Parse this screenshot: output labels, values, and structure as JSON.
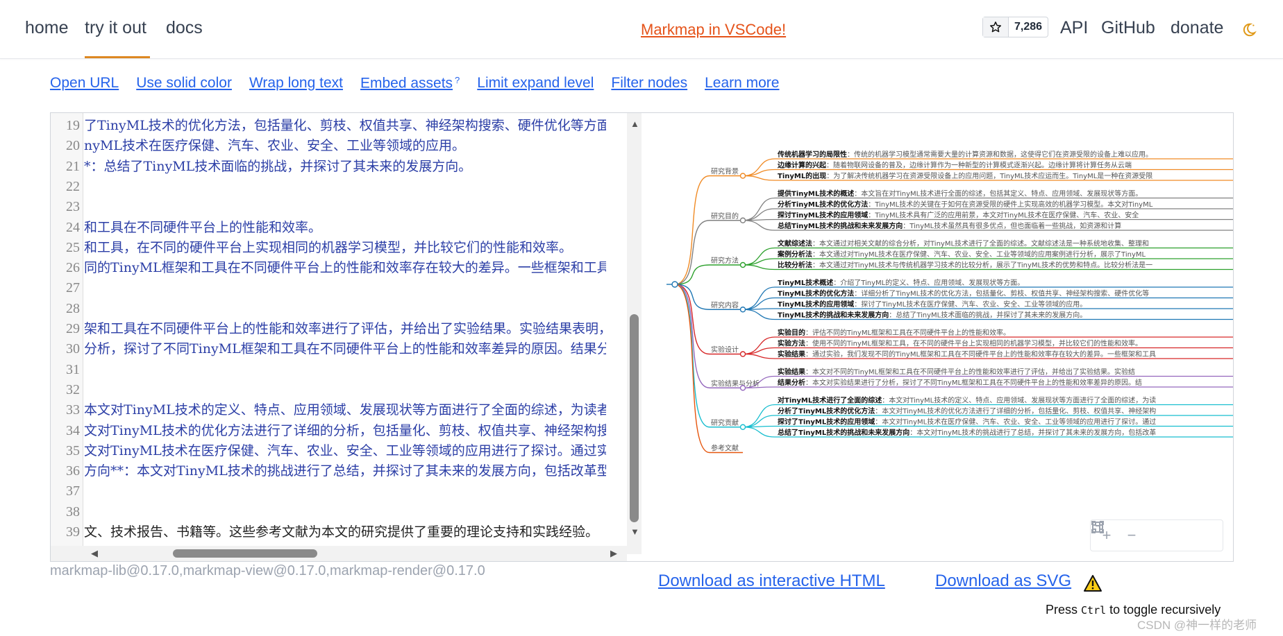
{
  "nav": {
    "items": [
      {
        "label": "home"
      },
      {
        "label": "try it out"
      },
      {
        "label": "docs"
      }
    ],
    "promo": "Markmap in VSCode!",
    "stars": "7,286",
    "right": [
      "API",
      "GitHub",
      "donate"
    ],
    "accent": "#dd8822"
  },
  "toolbar_links": [
    "Open URL",
    "Use solid color",
    "Wrap long text",
    "Embed assets",
    "Limit expand level",
    "Filter nodes",
    "Learn more"
  ],
  "embed_sup": "?",
  "editor": {
    "lines": [
      {
        "n": "19",
        "text": "了TinyML技术的优化方法，包括量化、剪枝、权值共享、神经架构搜索、硬件优化等方面。"
      },
      {
        "n": "20",
        "text": "nyML技术在医疗保健、汽车、农业、安全、工业等领域的应用。"
      },
      {
        "n": "21",
        "text": "*：总结了TinyML技术面临的挑战，并探讨了其未来的发展方向。"
      },
      {
        "n": "22",
        "text": ""
      },
      {
        "n": "23",
        "text": ""
      },
      {
        "n": "24",
        "text": "和工具在不同硬件平台上的性能和效率。"
      },
      {
        "n": "25",
        "text": "和工具，在不同的硬件平台上实现相同的机器学习模型，并比较它们的性能和效率。"
      },
      {
        "n": "26",
        "text": "同的TinyML框架和工具在不同硬件平台上的性能和效率存在较大的差异。一些框架和工具在"
      },
      {
        "n": "27",
        "text": ""
      },
      {
        "n": "28",
        "text": ""
      },
      {
        "n": "29",
        "text": "架和工具在不同硬件平台上的性能和效率进行了评估，并给出了实验结果。实验结果表明，"
      },
      {
        "n": "30",
        "text": "分析，探讨了不同TinyML框架和工具在不同硬件平台上的性能和效率差异的原因。结果分析"
      },
      {
        "n": "31",
        "text": ""
      },
      {
        "n": "32",
        "text": ""
      },
      {
        "n": "33",
        "text": "本文对TinyML技术的定义、特点、应用领域、发展现状等方面进行了全面的综述，为读者提"
      },
      {
        "n": "34",
        "text": "文对TinyML技术的优化方法进行了详细的分析，包括量化、剪枝、权值共享、神经架构搜索"
      },
      {
        "n": "35",
        "text": "文对TinyML技术在医疗保健、汽车、农业、安全、工业等领域的应用进行了探讨。通过实际"
      },
      {
        "n": "36",
        "text": "方向**：本文对TinyML技术的挑战进行了总结，并探讨了其未来的发展方向，包括改革型Ti"
      },
      {
        "n": "37",
        "text": ""
      },
      {
        "n": "38",
        "text": ""
      },
      {
        "n": "39",
        "text": "文、技术报告、书籍等。这些参考文献为本文的研究提供了重要的理论支持和实践经验。"
      }
    ]
  },
  "mindmap": {
    "branches": [
      {
        "label": "研究背景",
        "color": "#f08a24",
        "leaves": [
          {
            "key": "传统机器学习的局限性",
            "text": "：传统的机器学习模型通常需要大量的计算资源和数据，这使得它们在资源受限的设备上难以应用。"
          },
          {
            "key": "边缘计算的兴起",
            "text": "：随着物联网设备的普及，边缘计算作为一种新型的计算模式逐渐兴起。边缘计算将计算任务从云端"
          },
          {
            "key": "TinyML的出现",
            "text": "：为了解决传统机器学习在资源受限设备上的应用问题，TinyML技术应运而生。TinyML是一种在资源受限"
          }
        ]
      },
      {
        "label": "研究目的",
        "color": "#808080",
        "leaves": [
          {
            "key": "提供TinyML技术的概述",
            "text": "：本文旨在对TinyML技术进行全面的综述，包括其定义、特点、应用领域、发展现状等方面。"
          },
          {
            "key": "分析TinyML技术的优化方法",
            "text": "：TinyML技术的关键在于如何在资源受限的硬件上实现高效的机器学习模型。本文对TinyML"
          },
          {
            "key": "探讨TinyML技术的应用领域",
            "text": "：TinyML技术具有广泛的应用前景，本文对TinyML技术在医疗保健、汽车、农业、安全"
          },
          {
            "key": "总结TinyML技术的挑战和未来发展方向",
            "text": "：TinyML技术虽然具有很多优点，但也面临着一些挑战，如资源和计算"
          }
        ]
      },
      {
        "label": "研究方法",
        "color": "#2ca02c",
        "leaves": [
          {
            "key": "文献综述法",
            "text": "：本文通过对相关文献的综合分析，对TinyML技术进行了全面的综述。文献综述法是一种系统地收集、整理和"
          },
          {
            "key": "案例分析法",
            "text": "：本文通过对TinyML技术在医疗保健、汽车、农业、安全、工业等领域的应用案例进行分析，展示了TinyML"
          },
          {
            "key": "比较分析法",
            "text": "：本文通过对TinyML技术与传统机器学习技术的比较分析，展示了TinyML技术的优势和特点。比较分析法是一"
          }
        ]
      },
      {
        "label": "研究内容",
        "color": "#1f77b4",
        "leaves": [
          {
            "key": "TinyML技术概述",
            "text": "：介绍了TinyML的定义、特点、应用领域、发展现状等方面。"
          },
          {
            "key": "TinyML技术的优化方法",
            "text": "：详细分析了TinyML技术的优化方法，包括量化、剪枝、权值共享、神经架构搜索、硬件优化等"
          },
          {
            "key": "TinyML技术的应用领域",
            "text": "：探讨了TinyML技术在医疗保健、汽车、农业、安全、工业等领域的应用。"
          },
          {
            "key": "TinyML技术的挑战和未来发展方向",
            "text": "：总结了TinyML技术面临的挑战，并探讨了其未来的发展方向。"
          }
        ]
      },
      {
        "label": "实验设计",
        "color": "#d62728",
        "leaves": [
          {
            "key": "实验目的",
            "text": "：评估不同的TinyML框架和工具在不同硬件平台上的性能和效率。"
          },
          {
            "key": "实验方法",
            "text": "：使用不同的TinyML框架和工具，在不同的硬件平台上实现相同的机器学习模型，并比较它们的性能和效率。"
          },
          {
            "key": "实验结果",
            "text": "：通过实验，我们发现不同的TinyML框架和工具在不同硬件平台上的性能和效率存在较大的差异。一些框架和工具"
          }
        ]
      },
      {
        "label": "实验结果与分析",
        "color": "#9467bd",
        "leaves": [
          {
            "key": "实验结果",
            "text": "：本文对不同的TinyML框架和工具在不同硬件平台上的性能和效率进行了评估，并给出了实验结果。实验结"
          },
          {
            "key": "结果分析",
            "text": "：本文对实验结果进行了分析，探讨了不同TinyML框架和工具在不同硬件平台上的性能和效率差异的原因。结"
          }
        ]
      },
      {
        "label": "研究贡献",
        "color": "#17becf",
        "leaves": [
          {
            "key": "对TinyML技术进行了全面的综述",
            "text": "：本文对TinyML技术的定义、特点、应用领域、发展现状等方面进行了全面的综述，为读"
          },
          {
            "key": "分析了TinyML技术的优化方法",
            "text": "：本文对TinyML技术的优化方法进行了详细的分析，包括量化、剪枝、权值共享、神经架构"
          },
          {
            "key": "探讨了TinyML技术的应用领域",
            "text": "：本文对TinyML技术在医疗保健、汽车、农业、安全、工业等领域的应用进行了探讨。通过"
          },
          {
            "key": "总结了TinyML技术的挑战和未来发展方向",
            "text": "：本文对TinyML技术的挑战进行了总结，并探讨了其未来的发展方向，包括改革"
          }
        ]
      },
      {
        "label": "参考文献",
        "color": "#e6550d",
        "leaves": []
      }
    ]
  },
  "footer": {
    "versions": "markmap-lib@0.17.0,markmap-view@0.17.0,markmap-render@0.17.0",
    "download_html": "Download as interactive HTML",
    "download_svg": "Download as SVG",
    "hint_prefix": "Press ",
    "hint_key": "Ctrl",
    "hint_suffix": " to toggle recursively",
    "watermark": "CSDN @神一样的老师"
  }
}
